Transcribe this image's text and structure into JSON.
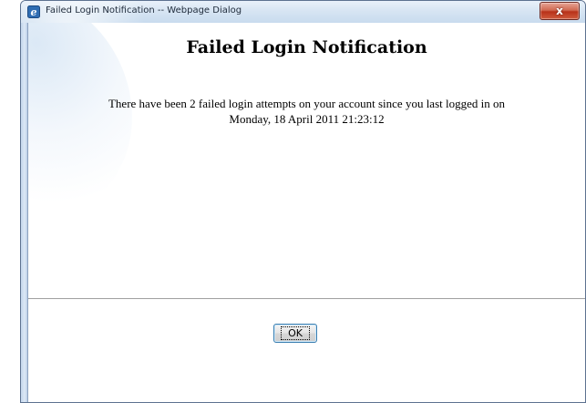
{
  "window": {
    "title": "Failed Login Notification -- Webpage Dialog",
    "app_icon": "ie-icon",
    "close_icon": "close-icon",
    "close_symbol": "x"
  },
  "content": {
    "heading": "Failed Login Notification",
    "message_line1": "There have been 2 failed login attempts on your account since you last logged in on",
    "message_line2": "Monday, 18 April 2011 21:23:12"
  },
  "buttons": {
    "ok_label": "OK"
  }
}
